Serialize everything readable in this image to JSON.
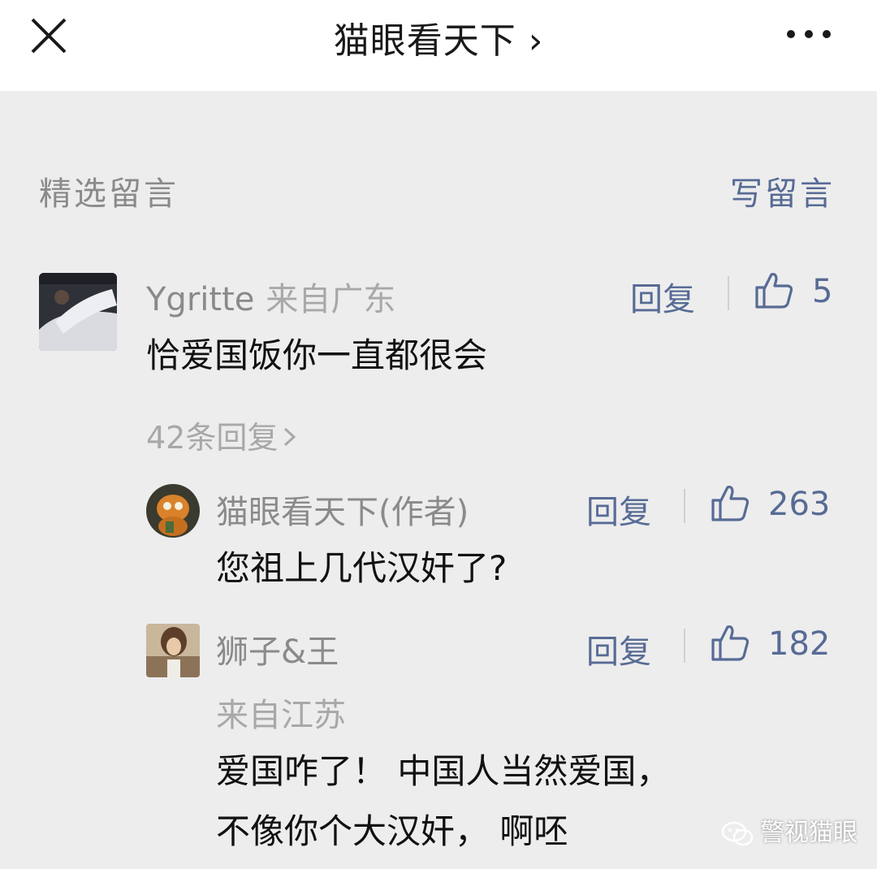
{
  "header": {
    "title": "猫眼看天下 ›"
  },
  "comments_section": {
    "title": "精选留言",
    "write_label": "写留言"
  },
  "comments": [
    {
      "user": "Ygritte",
      "location": "来自广东",
      "reply_label": "回复",
      "likes": "5",
      "content": "恰爱国饭你一直都很会",
      "more_replies": "42条回复",
      "replies": [
        {
          "user": "猫眼看天下(作者)",
          "reply_label": "回复",
          "likes": "263",
          "content": "您祖上几代汉奸了?"
        },
        {
          "user": "狮子&王",
          "location": "来自江苏",
          "reply_label": "回复",
          "likes": "182",
          "content_lines": [
            "爱国咋了！ 中国人当然爱国，",
            "不像你个大汉奸， 啊呸"
          ]
        }
      ]
    }
  ],
  "watermark": "警视猫眼",
  "colors": {
    "link": "#576b95",
    "muted": "#8a8a8a",
    "background": "#ededed"
  },
  "icons": [
    "close-icon",
    "more-dots-icon",
    "thumbs-up-icon",
    "wechat-icon"
  ]
}
